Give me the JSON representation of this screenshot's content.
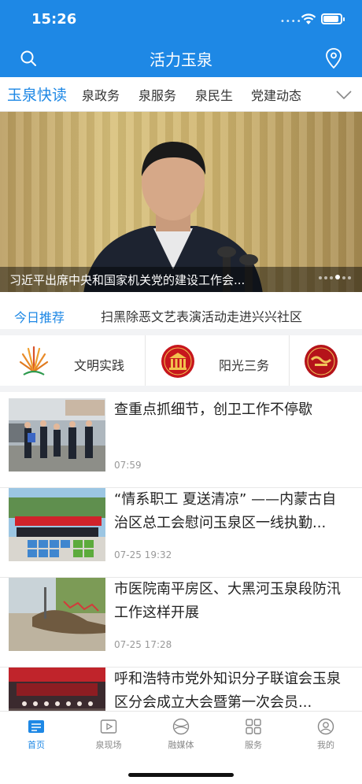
{
  "status": {
    "time": "15:26"
  },
  "header": {
    "title": "活力玉泉",
    "icons": [
      "search-icon",
      "location-icon"
    ]
  },
  "tabs": [
    {
      "label": "玉泉快读",
      "active": true
    },
    {
      "label": "泉政务"
    },
    {
      "label": "泉服务"
    },
    {
      "label": "泉民生"
    },
    {
      "label": "党建动态"
    }
  ],
  "banner": {
    "caption": "习近平出席中央和国家机关党的建设工作会...",
    "slide_count": 6,
    "active_slide": 4
  },
  "today": {
    "label": "今日推荐",
    "headline": "扫黑除恶文艺表演活动走进兴兴社区"
  },
  "services": [
    {
      "label": "文明实践",
      "icon": "civilization-practice-logo-icon"
    },
    {
      "label": "阳光三务",
      "icon": "sunshine-affairs-building-icon"
    },
    {
      "label": "",
      "icon": "study-emblem-icon"
    }
  ],
  "news": [
    {
      "title": "查重点抓细节，创卫工作不停歇",
      "time": "07:59"
    },
    {
      "title": "“情系职工 夏送清凉” ——内蒙古自治区总工会慰问玉泉区一线执勤...",
      "time": "07-25 19:32"
    },
    {
      "title": "市医院南平房区、大黑河玉泉段防汛工作这样开展",
      "time": "07-25 17:28"
    },
    {
      "title": "呼和浩特市党外知识分子联谊会玉泉区分会成立大会暨第一次会员...",
      "time": ""
    }
  ],
  "bottom_nav": [
    {
      "label": "首页",
      "icon": "home-icon",
      "active": true
    },
    {
      "label": "泉现场",
      "icon": "video-icon"
    },
    {
      "label": "融媒体",
      "icon": "media-globe-icon"
    },
    {
      "label": "服务",
      "icon": "grid-icon"
    },
    {
      "label": "我的",
      "icon": "profile-icon"
    }
  ],
  "colors": {
    "primary": "#1e88e5",
    "divider": "#f2f3f5",
    "text": "#222222",
    "muted": "#999999"
  }
}
